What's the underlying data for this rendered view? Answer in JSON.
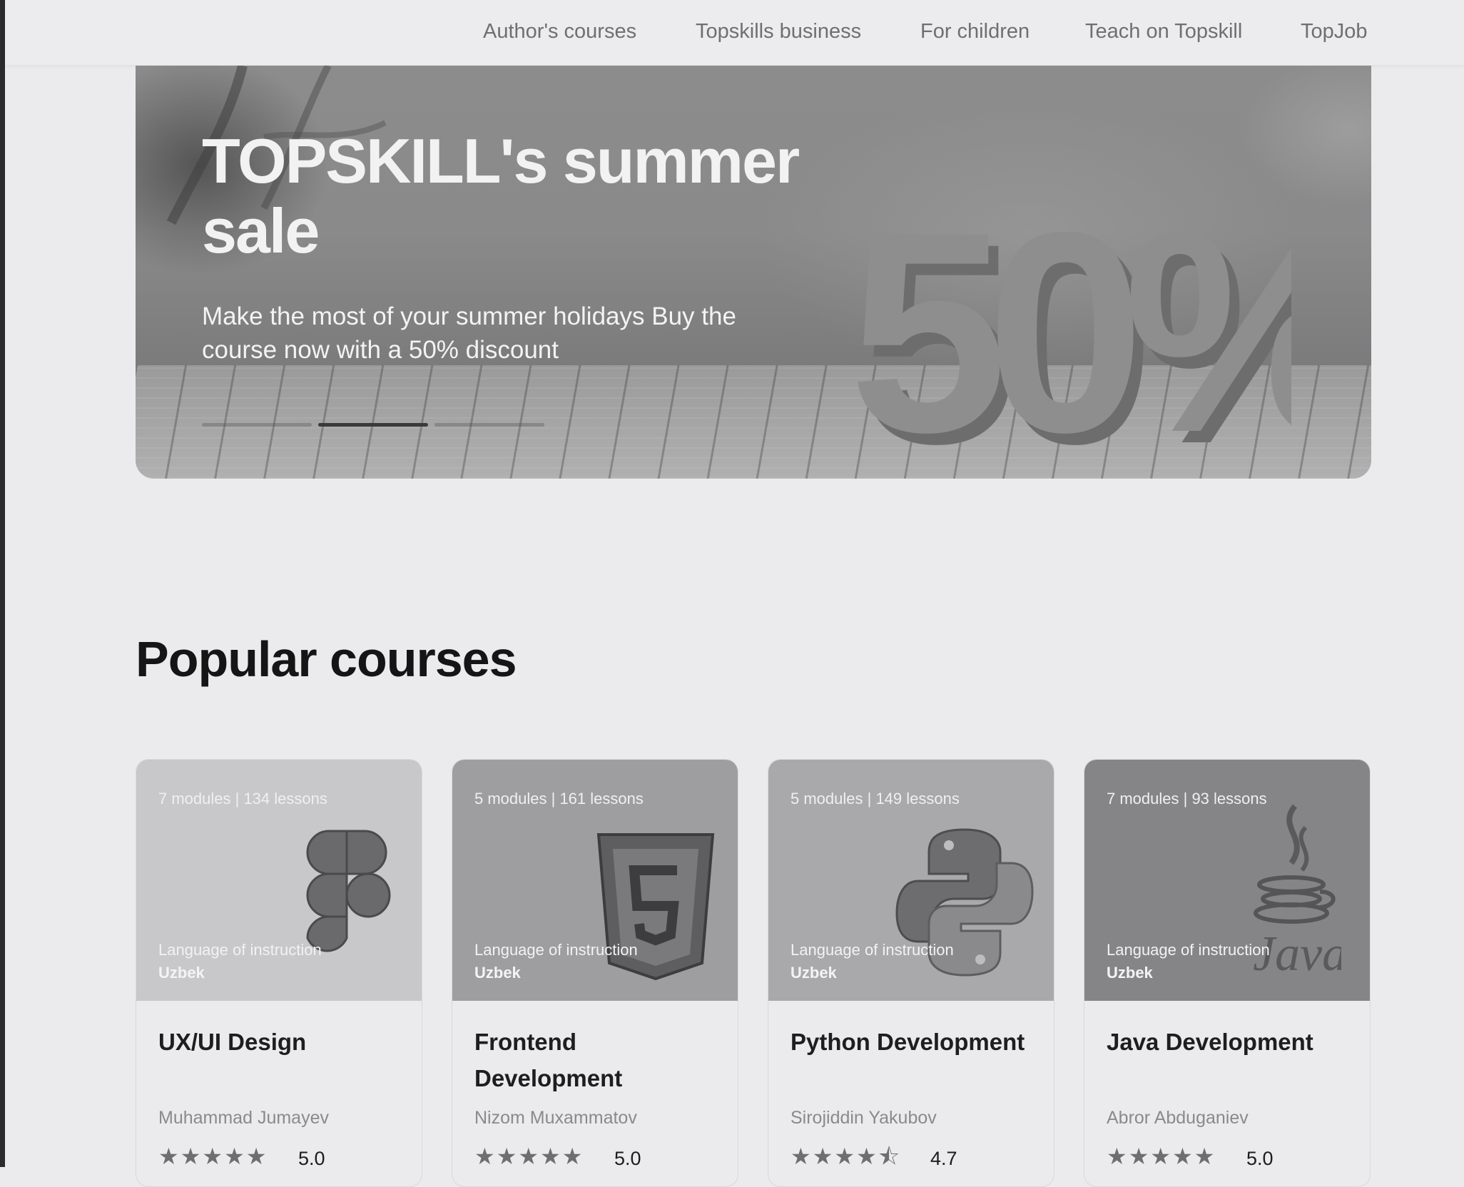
{
  "nav": {
    "links": [
      "Author's courses",
      "Topskills business",
      "For children",
      "Teach on Topskill",
      "TopJob"
    ]
  },
  "banner": {
    "title": "TOPSKILL's summer sale",
    "subtitle": "Make the most of your summer holidays Buy the course now with a 50% discount",
    "graphic_text": "50%",
    "slides": 3,
    "active_slide": 2
  },
  "section": {
    "title": "Popular courses"
  },
  "courses": [
    {
      "meta": "7 modules | 134 lessons",
      "lang_label": "Language of instruction",
      "lang": "Uzbek",
      "title": "UX/UI Design",
      "author": "Muhammad Jumayev",
      "stars": "★★★★★",
      "rating": "5.0",
      "icon": "figma-icon",
      "bg": "#c8c8ca"
    },
    {
      "meta": "5 modules | 161 lessons",
      "lang_label": "Language of instruction",
      "lang": "Uzbek",
      "title": "Frontend Development",
      "author": "Nizom Muxammatov",
      "stars": "★★★★★",
      "rating": "5.0",
      "icon": "html5-icon",
      "bg": "#9e9ea0"
    },
    {
      "meta": "5 modules | 149 lessons",
      "lang_label": "Language of instruction",
      "lang": "Uzbek",
      "title": "Python Development",
      "author": "Sirojiddin Yakubov",
      "stars": "★★★★⯪",
      "rating": "4.7",
      "icon": "python-icon",
      "bg": "#a9a9ab"
    },
    {
      "meta": "7 modules | 93 lessons",
      "lang_label": "Language of instruction",
      "lang": "Uzbek",
      "title": "Java Development",
      "author": "Abror Abduganiev",
      "stars": "★★★★★",
      "rating": "5.0",
      "icon": "java-icon",
      "bg": "#858587"
    }
  ]
}
